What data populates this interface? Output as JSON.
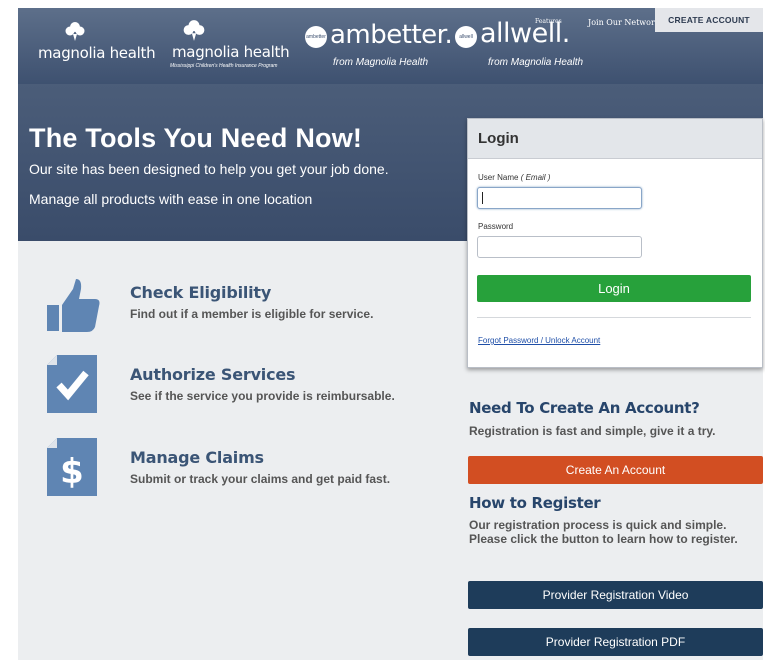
{
  "header": {
    "logos": [
      {
        "name": "magnolia health"
      },
      {
        "name": "magnolia health",
        "sub": "Mississippi Children's Health Insurance Program"
      },
      {
        "name": "ambetter.",
        "badge": "ambetter",
        "from": "from Magnolia Health"
      },
      {
        "name": "allwell.",
        "badge": "allwell",
        "from": "from Magnolia Health",
        "features": "Features",
        "join": "Join Our Network"
      }
    ],
    "create_account": "CREATE ACCOUNT"
  },
  "hero": {
    "title": "The Tools You Need Now!",
    "line1": "Our site has been designed to help you get your job done.",
    "line2": "Manage all products with ease in one location"
  },
  "features": [
    {
      "title": "Check Eligibility",
      "desc": "Find out if a member is eligible for service.",
      "icon": "thumbs-up-icon"
    },
    {
      "title": "Authorize Services",
      "desc": "See if the service you provide is reimbursable.",
      "icon": "checkmark-document-icon"
    },
    {
      "title": "Manage Claims",
      "desc": "Submit or track your claims and get paid fast.",
      "icon": "dollar-document-icon"
    }
  ],
  "login": {
    "title": "Login",
    "username_label": "User Name",
    "username_hint": "( Email )",
    "username_value": "",
    "password_label": "Password",
    "password_value": "",
    "button": "Login",
    "forgot": "Forgot Password / Unlock Account"
  },
  "create": {
    "title": "Need To Create An Account?",
    "text": "Registration is fast and simple, give it a try.",
    "button": "Create An Account"
  },
  "register": {
    "title": "How to Register",
    "text": "Our registration process is quick and simple. Please click the button to learn how to register.",
    "video_button": "Provider Registration Video",
    "pdf_button": "Provider Registration PDF"
  },
  "colors": {
    "header": "#4a5c78",
    "accent_green": "#27a13b",
    "accent_orange": "#d24e22",
    "navy": "#1e3c5a",
    "feature_title": "#3b5576"
  }
}
